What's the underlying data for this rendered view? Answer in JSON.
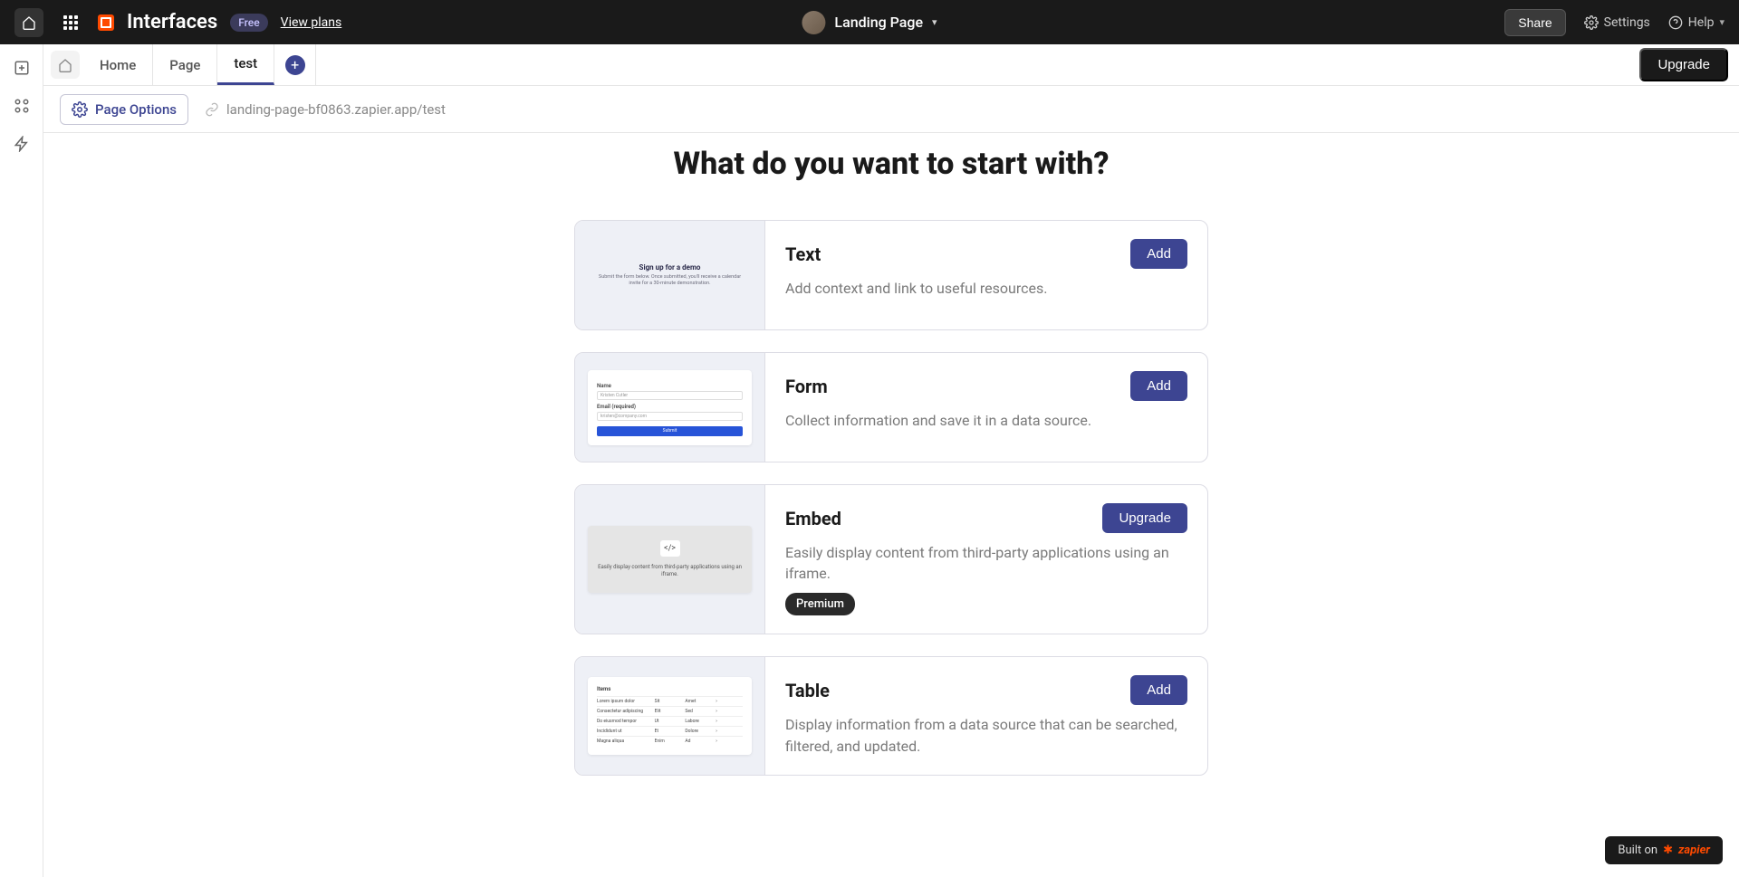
{
  "topbar": {
    "brand": "Interfaces",
    "plan_badge": "Free",
    "view_plans": "View plans",
    "page_title": "Landing Page",
    "share": "Share",
    "settings": "Settings",
    "help": "Help"
  },
  "tabs": {
    "items": [
      "Home",
      "Page",
      "test"
    ],
    "active_index": 2,
    "upgrade": "Upgrade"
  },
  "options": {
    "page_options": "Page Options",
    "url": "landing-page-bf0863.zapier.app/test"
  },
  "content": {
    "heading": "What do you want to start with?",
    "cards": [
      {
        "title": "Text",
        "desc": "Add context and link to useful resources.",
        "button": "Add",
        "preview": {
          "type": "demo",
          "line1": "Sign up for a demo",
          "line2": "Submit the form below. Once submitted, you'll receive a calendar invite for a 30-minute demonstration."
        }
      },
      {
        "title": "Form",
        "desc": "Collect information and save it in a data source.",
        "button": "Add",
        "preview": {
          "type": "form",
          "name_label": "Name",
          "name_value": "Kristen Cutler",
          "email_label": "Email (required)",
          "email_value": "kristen@company.com",
          "submit": "Submit"
        }
      },
      {
        "title": "Embed",
        "desc": "Easily display content from third-party applications using an iframe.",
        "button": "Upgrade",
        "premium": "Premium",
        "preview": {
          "type": "embed",
          "line2": "Easily display content from third-party applications using an iframe."
        }
      },
      {
        "title": "Table",
        "desc": "Display information from a data source that can be searched, filtered, and updated.",
        "button": "Add",
        "preview": {
          "type": "table",
          "header": "Items"
        }
      }
    ]
  },
  "footer": {
    "built_on": "Built on",
    "brand": "zapier"
  }
}
